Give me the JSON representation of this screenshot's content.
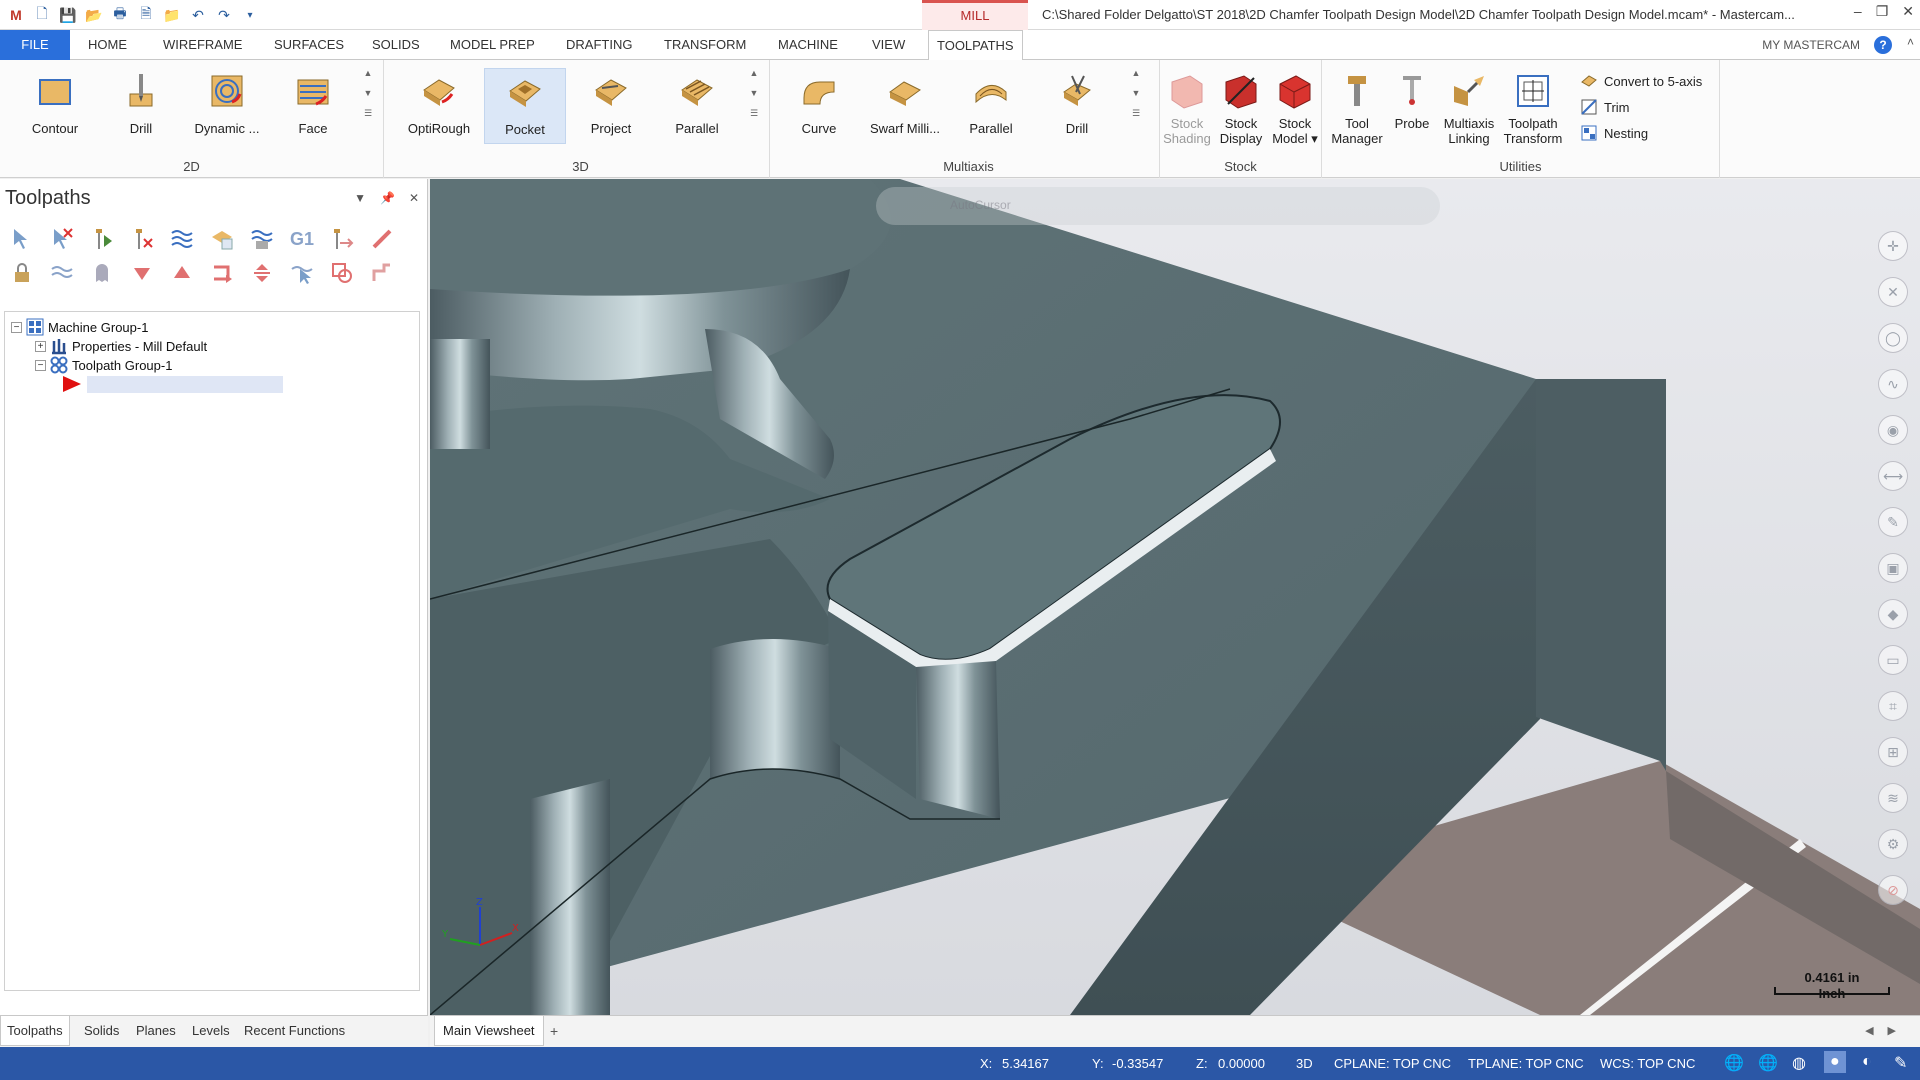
{
  "titlebar": {
    "context_tab": "MILL",
    "title": "C:\\Shared Folder Delgatto\\ST 2018\\2D Chamfer Toolpath Design Model\\2D Chamfer Toolpath Design Model.mcam* - Mastercam...",
    "minimize": "–",
    "restore": "❐",
    "close": "✕"
  },
  "tabs": [
    {
      "label": "FILE"
    },
    {
      "label": "HOME"
    },
    {
      "label": "WIREFRAME"
    },
    {
      "label": "SURFACES"
    },
    {
      "label": "SOLIDS"
    },
    {
      "label": "MODEL PREP"
    },
    {
      "label": "DRAFTING"
    },
    {
      "label": "TRANSFORM"
    },
    {
      "label": "MACHINE"
    },
    {
      "label": "VIEW"
    },
    {
      "label": "TOOLPATHS"
    }
  ],
  "my_mastercam": "MY MASTERCAM",
  "help": "?",
  "ribbon": {
    "group_2d": {
      "label": "2D",
      "buttons": [
        "Contour",
        "Drill",
        "Dynamic ...",
        "Face"
      ]
    },
    "group_3d": {
      "label": "3D",
      "buttons": [
        "OptiRough",
        "Pocket",
        "Project",
        "Parallel"
      ]
    },
    "group_multiaxis": {
      "label": "Multiaxis",
      "buttons": [
        "Curve",
        "Swarf Milli...",
        "Parallel",
        "Drill"
      ]
    },
    "group_stock": {
      "label": "Stock",
      "buttons": [
        {
          "line1": "Stock",
          "line2": "Shading"
        },
        {
          "line1": "Stock",
          "line2": "Display"
        },
        {
          "line1": "Stock",
          "line2": "Model ▾"
        }
      ]
    },
    "group_utilities": {
      "label": "Utilities",
      "buttons": [
        {
          "line1": "Tool",
          "line2": "Manager"
        },
        {
          "line1": "Probe",
          "line2": ""
        },
        {
          "line1": "Multiaxis",
          "line2": "Linking"
        },
        {
          "line1": "Toolpath",
          "line2": "Transform"
        }
      ],
      "small": [
        "Convert to 5-axis",
        "Trim",
        "Nesting"
      ]
    }
  },
  "left_panel": {
    "title": "Toolpaths",
    "tree": {
      "machine_group": "Machine Group-1",
      "properties": "Properties - Mill Default",
      "toolpath_group": "Toolpath Group-1",
      "new_item": ""
    },
    "bottom_tabs": [
      "Toolpaths",
      "Solids",
      "Planes",
      "Levels",
      "Recent Functions"
    ]
  },
  "viewport": {
    "floatbar_label": "AutoCursor",
    "scale_value": "0.4161 in",
    "scale_unit": "Inch",
    "triad": {
      "x": "X",
      "y": "Y",
      "z": "Z"
    }
  },
  "view_tabs": {
    "main": "Main Viewsheet",
    "add": "+"
  },
  "status": {
    "x_label": "X:",
    "x_value": "5.34167",
    "y_label": "Y:",
    "y_value": "-0.33547",
    "z_label": "Z:",
    "z_value": "0.00000",
    "mode": "3D",
    "cplane": "CPLANE: TOP CNC",
    "tplane": "TPLANE: TOP CNC",
    "wcs": "WCS: TOP CNC"
  },
  "colors": {
    "file_tab": "#2a6fdb",
    "status_bar": "#2b57a6",
    "mill_context": "#d9534f",
    "part_surface": "#5c6f73",
    "floor": "#8a7d7a"
  }
}
